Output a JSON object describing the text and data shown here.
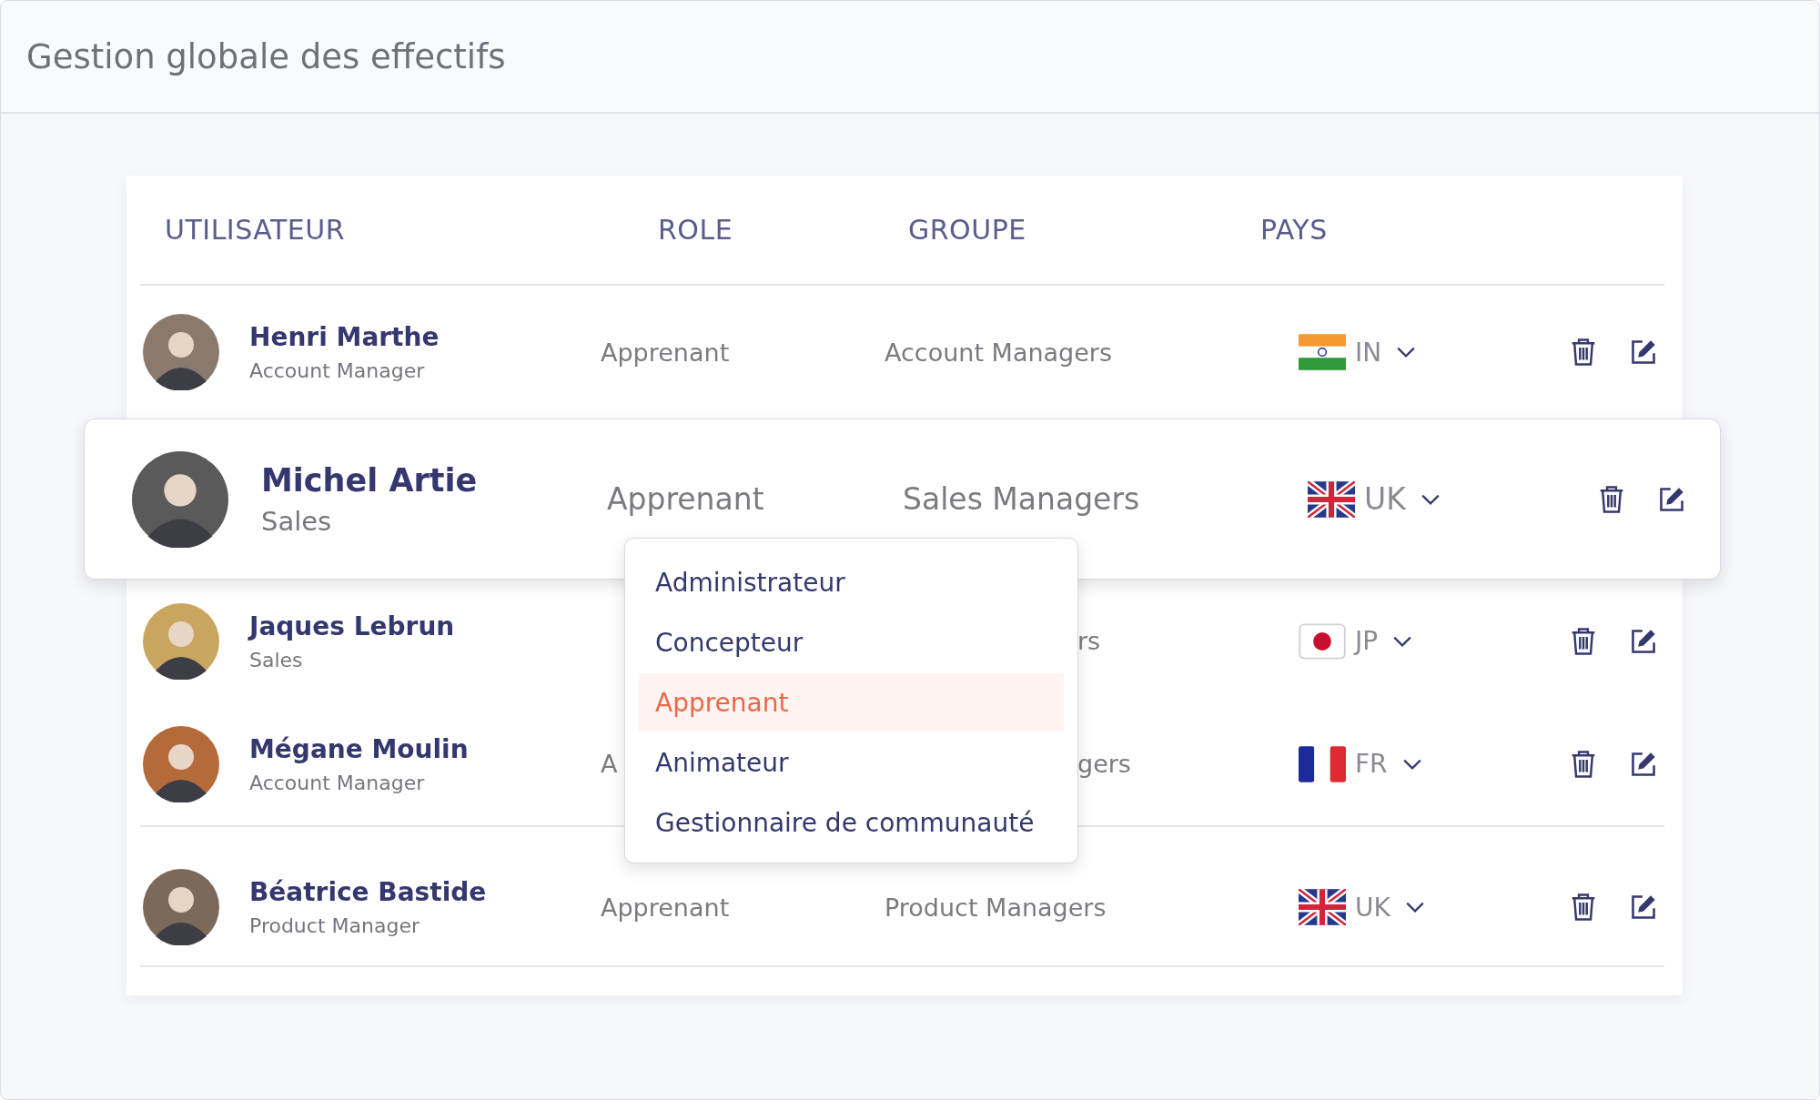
{
  "page": {
    "title": "Gestion globale des effectifs"
  },
  "table": {
    "columns": [
      "UTILISATEUR",
      "ROLE",
      "GROUPE",
      "PAYS"
    ],
    "rows": [
      {
        "name": "Henri Marthe",
        "subtitle": "Account Manager",
        "role": "Apprenant",
        "group": "Account Managers",
        "country": {
          "code": "IN",
          "kind": "india"
        },
        "highlighted": false,
        "covered": false
      },
      {
        "name": "Michel Artie",
        "subtitle": "Sales",
        "role": "Apprenant",
        "group": "Sales Managers",
        "country": {
          "code": "UK",
          "kind": "uk"
        },
        "highlighted": true,
        "covered": false
      },
      {
        "name": "Jaques Lebrun",
        "subtitle": "Sales",
        "group": "rs",
        "country": {
          "code": "JP",
          "kind": "japan"
        },
        "highlighted": false,
        "covered": true
      },
      {
        "name": "Mégane Moulin",
        "subtitle": "Account Manager",
        "role": "A",
        "group": "gers",
        "country": {
          "code": "FR",
          "kind": "france"
        },
        "highlighted": false,
        "covered": true
      },
      {
        "name": "Béatrice Bastide",
        "subtitle": "Product Manager",
        "role": "Apprenant",
        "group": "Product Managers",
        "country": {
          "code": "UK",
          "kind": "uk"
        },
        "highlighted": false,
        "covered": false
      }
    ]
  },
  "role_menu": {
    "items": [
      {
        "label": "Administrateur",
        "selected": false
      },
      {
        "label": "Concepteur",
        "selected": false
      },
      {
        "label": "Apprenant",
        "selected": true
      },
      {
        "label": "Animateur",
        "selected": false
      },
      {
        "label": "Gestionnaire de communauté",
        "selected": false
      }
    ]
  }
}
